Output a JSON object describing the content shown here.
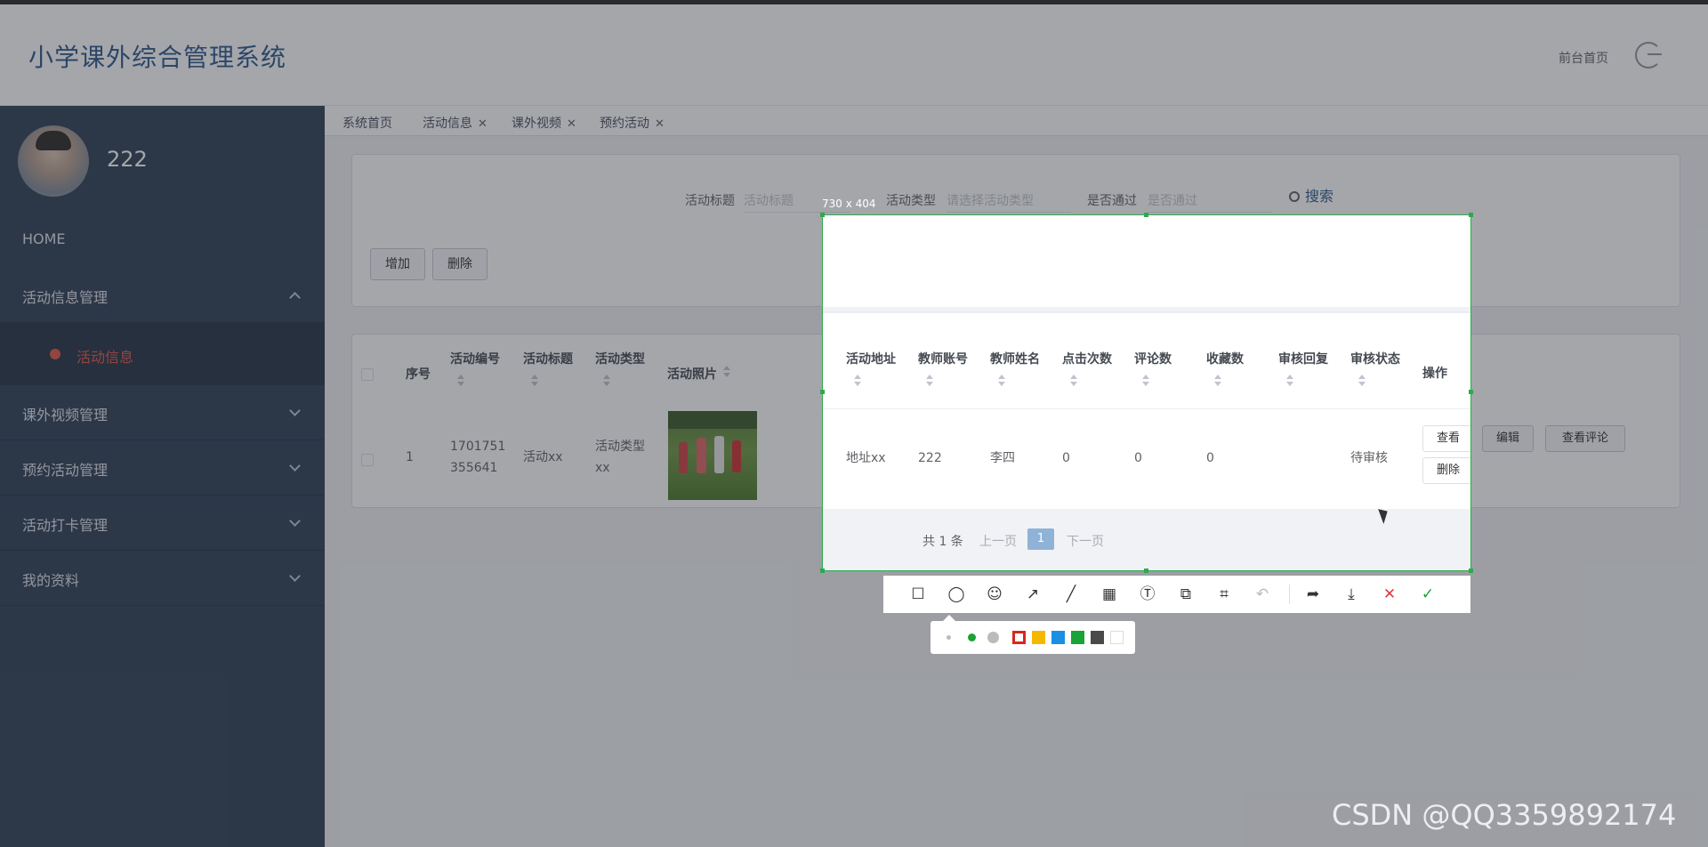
{
  "header": {
    "title": "小学课外综合管理系统",
    "front_link": "前台首页"
  },
  "user": {
    "name": "222"
  },
  "sidebar": {
    "items": [
      {
        "label": "HOME"
      },
      {
        "label": "活动信息管理"
      },
      {
        "label": "课外视频管理"
      },
      {
        "label": "预约活动管理"
      },
      {
        "label": "活动打卡管理"
      },
      {
        "label": "我的资料"
      }
    ],
    "active_sub": "活动信息"
  },
  "tabs": [
    {
      "label": "系统首页"
    },
    {
      "label": "活动信息"
    },
    {
      "label": "课外视频"
    },
    {
      "label": "预约活动"
    }
  ],
  "search": {
    "title_label": "活动标题",
    "title_placeholder": "活动标题",
    "type_label": "活动类型",
    "type_placeholder": "请选择活动类型",
    "pass_label": "是否通过",
    "pass_placeholder": "是否通过",
    "search_button": "搜索",
    "add_button": "增加",
    "delete_button": "删除"
  },
  "table": {
    "headers": [
      "序号",
      "活动编号",
      "活动标题",
      "活动类型",
      "活动照片",
      "活动地址",
      "教师账号",
      "教师姓名",
      "点击次数",
      "评论数",
      "收藏数",
      "审核回复",
      "审核状态",
      "操作"
    ],
    "row": {
      "index": "1",
      "code_line1": "1701751",
      "code_line2": "355641",
      "title": "活动xx",
      "type_line1": "活动类型",
      "type_line2": "xx",
      "address": "地址xx",
      "teacher_account": "222",
      "teacher_name": "李四",
      "clicks": "0",
      "comments": "0",
      "favorites": "0",
      "reply": "",
      "status": "待审核"
    },
    "actions": {
      "view": "查看",
      "edit": "编辑",
      "view_comments": "查看评论",
      "delete": "删除"
    }
  },
  "pagination": {
    "total": "共 1 条",
    "prev": "上一页",
    "current": "1",
    "next": "下一页"
  },
  "capture": {
    "size_label": "730 x 404"
  },
  "colors": {
    "sidebar_bg": "#304156",
    "accent": "#2d5a8c",
    "active_sub": "#e05a4a",
    "capture_border": "#2fa84f"
  },
  "toolbar_icons": [
    "rectangle-icon",
    "ellipse-icon",
    "emoji-icon",
    "arrow-icon",
    "line-icon",
    "mosaic-icon",
    "text-icon",
    "pin-icon",
    "ocr-icon",
    "undo-icon",
    "share-icon",
    "download-icon",
    "cancel-icon",
    "confirm-icon"
  ],
  "palette_colors": [
    "#d9261c",
    "#f5b800",
    "#1a8fe3",
    "#1aa336",
    "#4a4a4a",
    "#ffffff"
  ],
  "watermark": "CSDN @QQ3359892174"
}
